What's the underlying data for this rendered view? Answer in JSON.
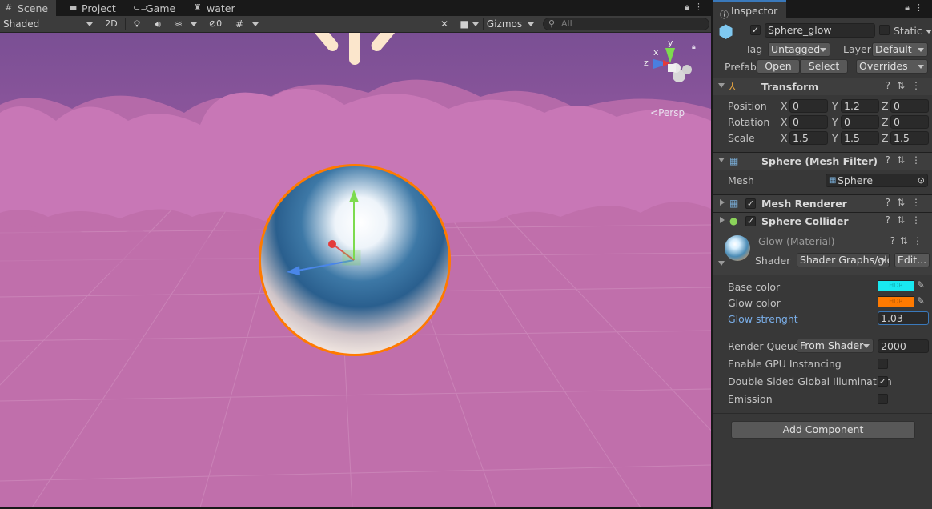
{
  "tabs": [
    {
      "label": "Scene",
      "icon": "scene-grid-icon",
      "active": true
    },
    {
      "label": "Project",
      "icon": "folder-icon",
      "active": false
    },
    {
      "label": "Game",
      "icon": "gamepad-icon",
      "active": false
    },
    {
      "label": "water",
      "icon": "robot-icon",
      "active": false
    }
  ],
  "scene_toolbar": {
    "shading_mode": "Shaded",
    "mode_2d": "2D",
    "hidden_count": "0",
    "gizmos": "Gizmos",
    "search_placeholder": "All"
  },
  "viewport": {
    "persp_label": "Persp",
    "axis_labels": {
      "x": "x",
      "y": "y",
      "z": "z"
    },
    "sky_color": "#7c4f94",
    "ground_color": "#c06fab",
    "cloud_color": "#c877b6",
    "glow_color": "#ff7a00"
  },
  "inspector": {
    "tab_label": "Inspector",
    "object_name": "Sphere_glow",
    "static_label": "Static",
    "tag_label": "Tag",
    "tag_value": "Untagged",
    "layer_label": "Layer",
    "layer_value": "Default",
    "prefab_label": "Prefab",
    "prefab_open": "Open",
    "prefab_select": "Select",
    "prefab_overrides": "Overrides",
    "transform": {
      "title": "Transform",
      "position_label": "Position",
      "rotation_label": "Rotation",
      "scale_label": "Scale",
      "position": {
        "x": "0",
        "y": "1.2",
        "z": "0"
      },
      "rotation": {
        "x": "0",
        "y": "0",
        "z": "0"
      },
      "scale": {
        "x": "1.5",
        "y": "1.5",
        "z": "1.5"
      }
    },
    "mesh_filter": {
      "title": "Sphere (Mesh Filter)",
      "mesh_label": "Mesh",
      "mesh_value": "Sphere"
    },
    "mesh_renderer": {
      "title": "Mesh Renderer"
    },
    "sphere_collider": {
      "title": "Sphere Collider"
    },
    "material": {
      "title": "Glow (Material)",
      "shader_label": "Shader",
      "shader_value": "Shader Graphs/glow",
      "edit_label": "Edit...",
      "base_color_label": "Base color",
      "base_color": "#19e8f0",
      "glow_color_label": "Glow color",
      "glow_color": "#ff7a00",
      "hdr_label": "HDR",
      "glow_strength_label": "Glow strenght",
      "glow_strength_value": "1.03",
      "render_queue_label": "Render Queue",
      "render_queue_mode": "From Shader",
      "render_queue_value": "2000",
      "gpu_instancing_label": "Enable GPU Instancing",
      "double_sided_gi_label": "Double Sided Global Illumination",
      "emission_label": "Emission"
    },
    "add_component": "Add Component"
  }
}
